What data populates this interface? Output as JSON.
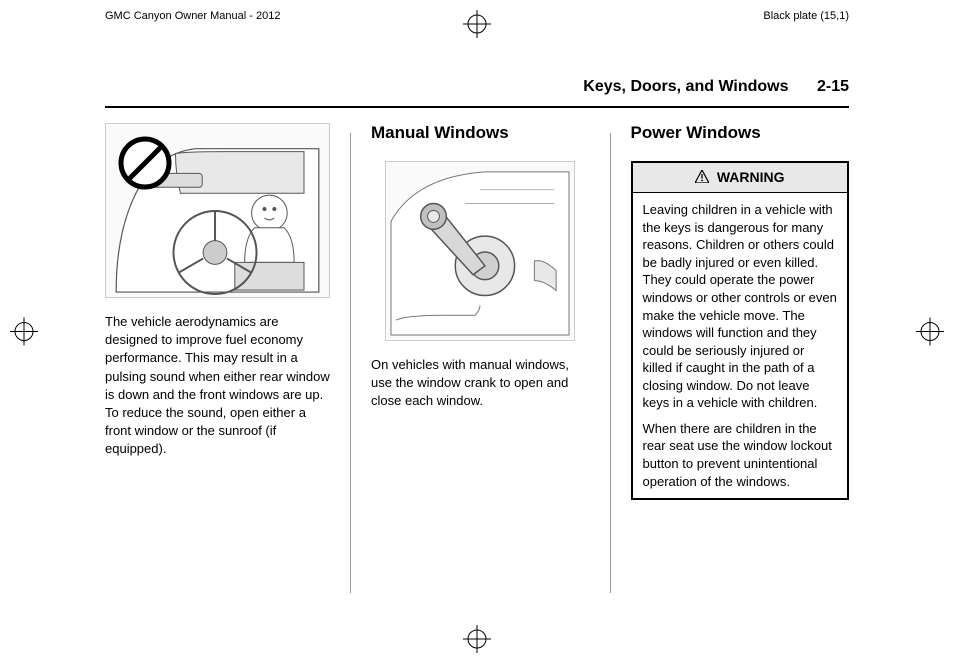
{
  "top_header": {
    "left": "GMC Canyon Owner Manual - 2012",
    "right": "Black plate (15,1)"
  },
  "page_header": {
    "section_title": "Keys, Doors, and Windows",
    "page_number": "2-15"
  },
  "column1": {
    "body": "The vehicle aerodynamics are designed to improve fuel economy performance. This may result in a pulsing sound when either rear window is down and the front windows are up. To reduce the sound, open either a front window or the sunroof (if equipped).",
    "illustration_alt": "Child in car seat with prohibition symbol"
  },
  "column2": {
    "heading": "Manual Windows",
    "body": "On vehicles with manual windows, use the window crank to open and close each window.",
    "illustration_alt": "Manual window crank handle"
  },
  "column3": {
    "heading": "Power Windows",
    "warning": {
      "label": "WARNING",
      "para1": "Leaving children in a vehicle with the keys is dangerous for many reasons. Children or others could be badly injured or even killed. They could operate the power windows or other controls or even make the vehicle move. The windows will function and they could be seriously injured or killed if caught in the path of a closing window. Do not leave keys in a vehicle with children.",
      "para2": "When there are children in the rear seat use the window lockout button to prevent unintentional operation of the windows."
    }
  }
}
